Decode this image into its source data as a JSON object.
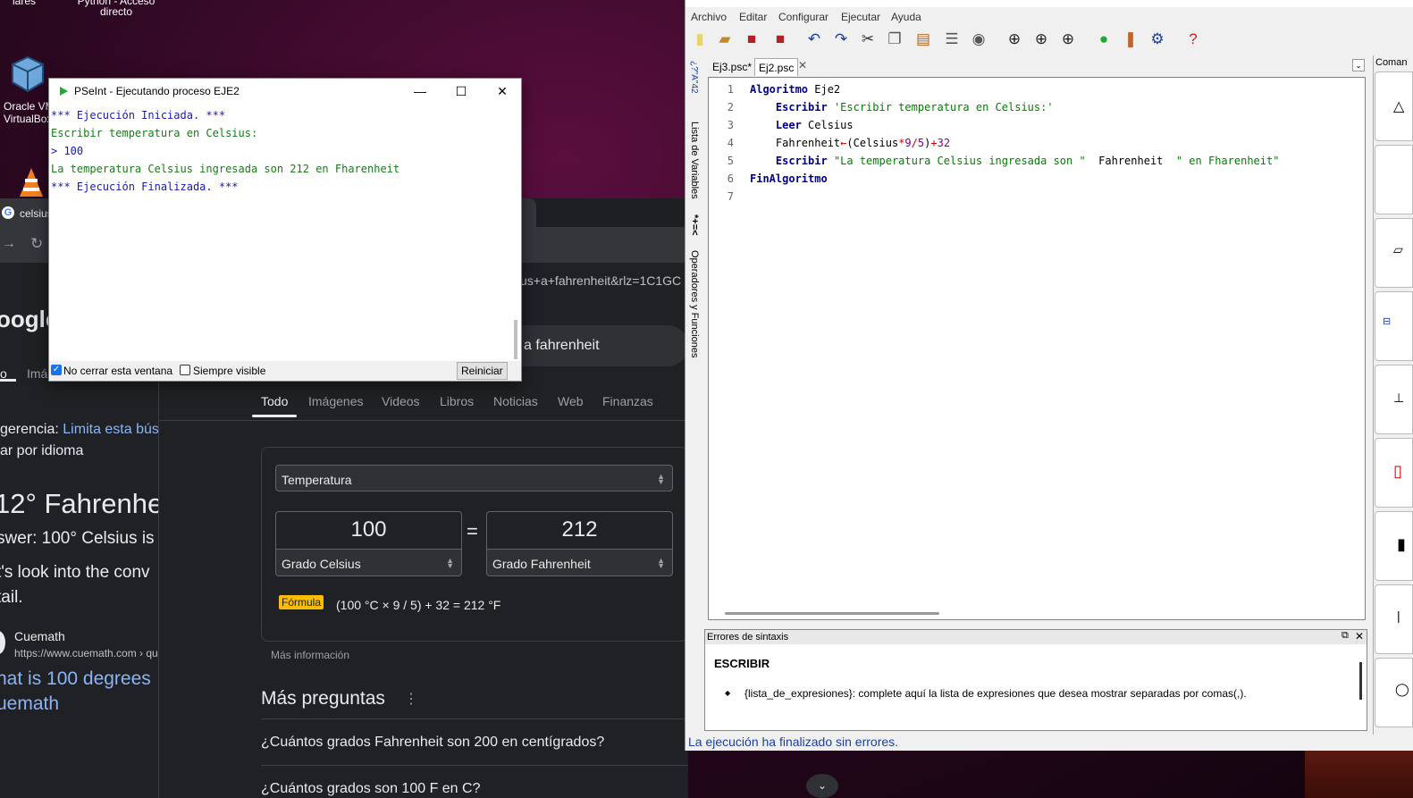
{
  "desktop": {
    "icon_top_label_1": "lares",
    "icon_top_label_2": "Python - Acceso",
    "icon_top_label_3": "directo",
    "vbox_label_1": "Oracle VM",
    "vbox_label_2": "VirtualBox"
  },
  "browser": {
    "tab_title": "celsius",
    "url_fragment": "us+a+fahrenheit&rlz=1C1GC",
    "search_query_fragment": "a fahrenheit",
    "logo_fragment": "oogle",
    "left_tab_fragment_1": "o",
    "left_tab_fragment_2": "Imá",
    "tabs": [
      "Todo",
      "Imágenes",
      "Videos",
      "Libros",
      "Noticias",
      "Web",
      "Finanzas"
    ],
    "left_texts": {
      "suggestion": "gerencia:",
      "suggestion_link": "Limita esta búsq",
      "search_by_language": "ar por idioma",
      "big_result": "12° Fahrenhei",
      "answer": "swer: 100° Celsius is",
      "look_into": "t's look into the conv",
      "detail": "tail.",
      "source_name": "Cuemath",
      "source_url": "https://www.cuemath.com › qu",
      "link_title_1": "hat is 100 degrees",
      "link_title_2": "uemath"
    },
    "converter": {
      "unit_type": "Temperatura",
      "from_value": "100",
      "to_value": "212",
      "equals": "=",
      "from_unit": "Grado Celsius",
      "to_unit": "Grado Fahrenheit",
      "formula_label": "Fórmula",
      "formula": "(100 °C × 9 / 5) + 32 = 212 °F"
    },
    "more_info": "Más información",
    "more_questions_title": "Más preguntas",
    "questions": [
      "¿Cuántos grados Fahrenheit son 200 en centígrados?",
      "¿Cuántos grados son 100 F en C?"
    ]
  },
  "console": {
    "title": "PSeInt - Ejecutando proceso EJE2",
    "lines": [
      "*** Ejecución Iniciada. ***",
      "Escribir temperatura en Celsius:",
      "> 100",
      "La temperatura Celsius ingresada son 212 en Fharenheit",
      "*** Ejecución Finalizada. ***"
    ],
    "keep_open_label": "No cerrar esta ventana",
    "always_visible_label": "Siempre visible",
    "restart_label": "Reiniciar",
    "keep_open_checked": true,
    "always_visible_checked": false
  },
  "ide": {
    "menu": [
      "Archivo",
      "Editar",
      "Configurar",
      "Ejecutar",
      "Ayuda"
    ],
    "tabs": [
      "Ej3.psc*",
      "Ej2.psc"
    ],
    "vertical_labels": {
      "variables": "Lista de Variables",
      "operators": "Operadores y Funciones",
      "variables_glyph": "¿?\"A\"42",
      "operators_glyph": "*+=<"
    },
    "line_numbers": [
      "1",
      "2",
      "3",
      "4",
      "5",
      "6",
      "7"
    ],
    "errors_title": "Errores de sintaxis",
    "help_keyword": "ESCRIBIR",
    "help_text": "{lista_de_expresiones}: complete aquí la lista de expresiones que desea mostrar separadas por comas(,).",
    "status": "La ejecución ha finalizado sin errores.",
    "right_panel_label": "Coman"
  }
}
